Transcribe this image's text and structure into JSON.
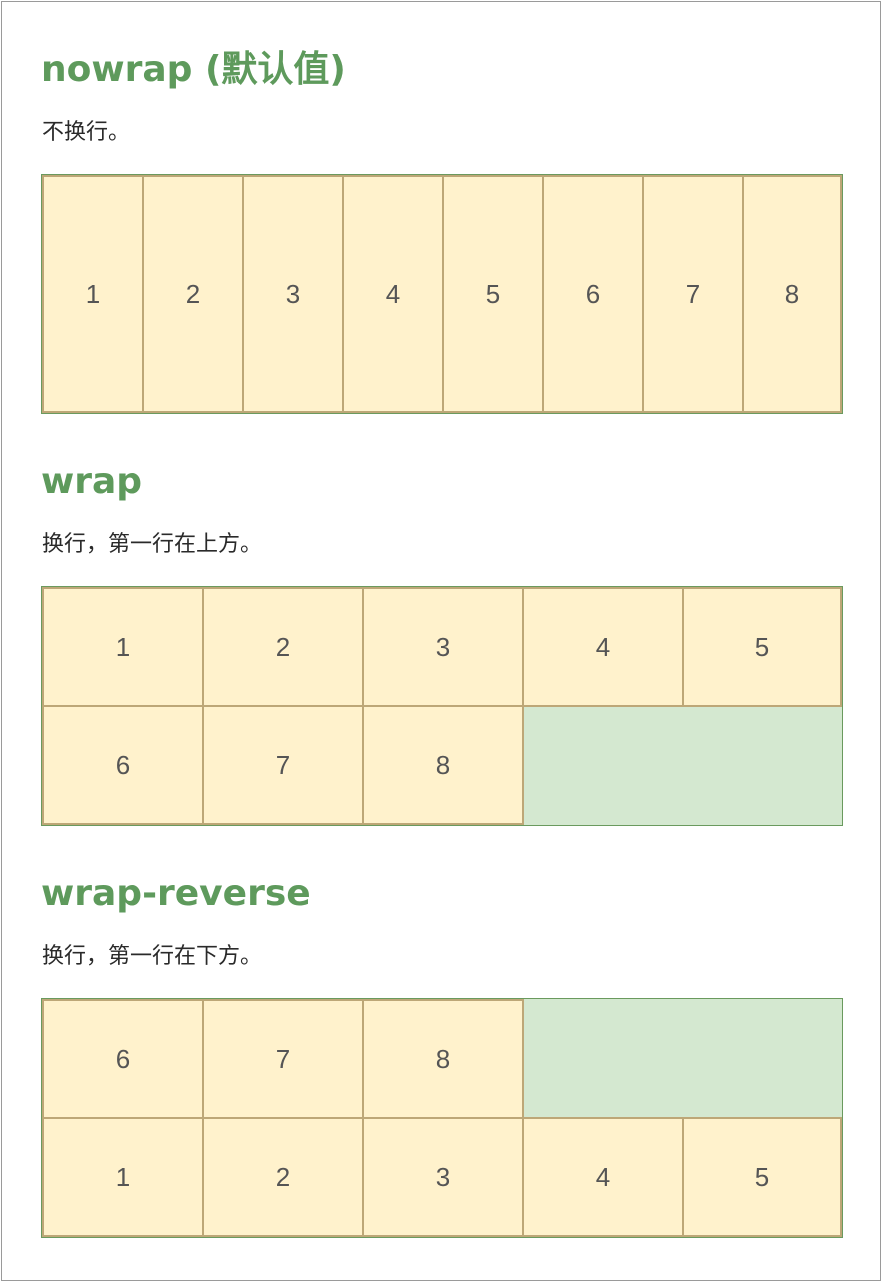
{
  "sections": [
    {
      "title": "nowrap (默认值)",
      "description": "不换行。",
      "items": [
        "1",
        "2",
        "3",
        "4",
        "5",
        "6",
        "7",
        "8"
      ]
    },
    {
      "title": "wrap",
      "description": "换行，第一行在上方。",
      "rows": [
        [
          "1",
          "2",
          "3",
          "4",
          "5"
        ],
        [
          "6",
          "7",
          "8"
        ]
      ]
    },
    {
      "title": "wrap-reverse",
      "description": "换行，第一行在下方。",
      "rows": [
        [
          "6",
          "7",
          "8"
        ],
        [
          "1",
          "2",
          "3",
          "4",
          "5"
        ]
      ]
    }
  ],
  "colors": {
    "title": "#5e9a5c",
    "item_fill": "#fff2cc",
    "item_border": "#bda777",
    "container_fill": "#d4e8d0",
    "container_border": "#6a9a5e"
  }
}
